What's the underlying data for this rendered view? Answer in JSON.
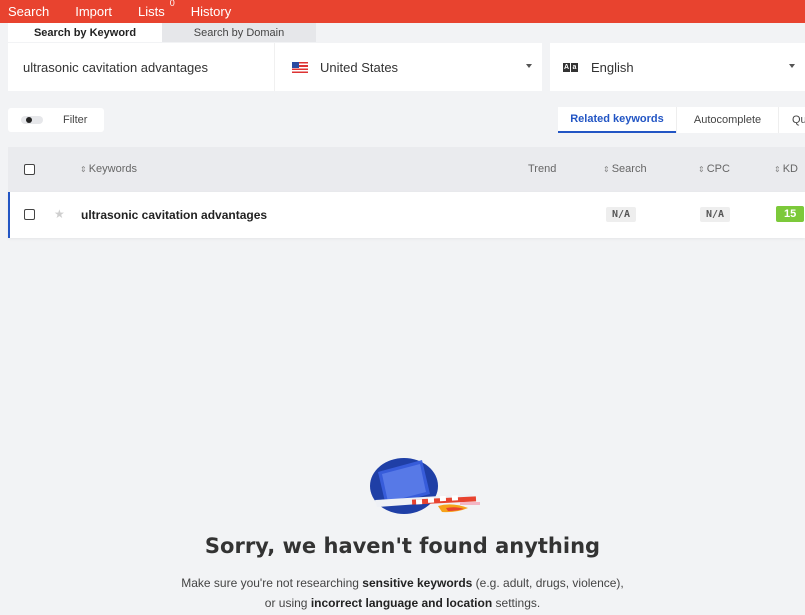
{
  "topnav": {
    "items": [
      {
        "label": "Search"
      },
      {
        "label": "Import"
      },
      {
        "label": "Lists",
        "count": "0"
      },
      {
        "label": "History"
      }
    ]
  },
  "search_tabs": {
    "keyword": "Search by Keyword",
    "domain": "Search by Domain"
  },
  "inputs": {
    "keyword_value": "ultrasonic cavitation advantages",
    "country": "United States",
    "language": "English"
  },
  "filter": {
    "label": "Filter"
  },
  "mode_tabs": {
    "related": "Related keywords",
    "autocomplete": "Autocomplete",
    "questions": "Qu"
  },
  "table": {
    "columns": {
      "keywords": "Keywords",
      "trend": "Trend",
      "search": "Search",
      "cpc": "CPC",
      "kd": "KD"
    },
    "rows": [
      {
        "keyword": "ultrasonic cavitation advantages",
        "search": "N/A",
        "cpc": "N/A",
        "kd": "15"
      }
    ]
  },
  "empty_state": {
    "title": "Sorry, we haven't found anything",
    "line1_pre": "Make sure you're not researching ",
    "line1_bold": "sensitive keywords",
    "line1_post": " (e.g. adult, drugs, violence),",
    "line2_pre": "or using ",
    "line2_bold": "incorrect language and location",
    "line2_post": " settings."
  },
  "colors": {
    "brand": "#e8432f",
    "accent": "#2255c4",
    "kd_easy": "#7cc93a"
  }
}
